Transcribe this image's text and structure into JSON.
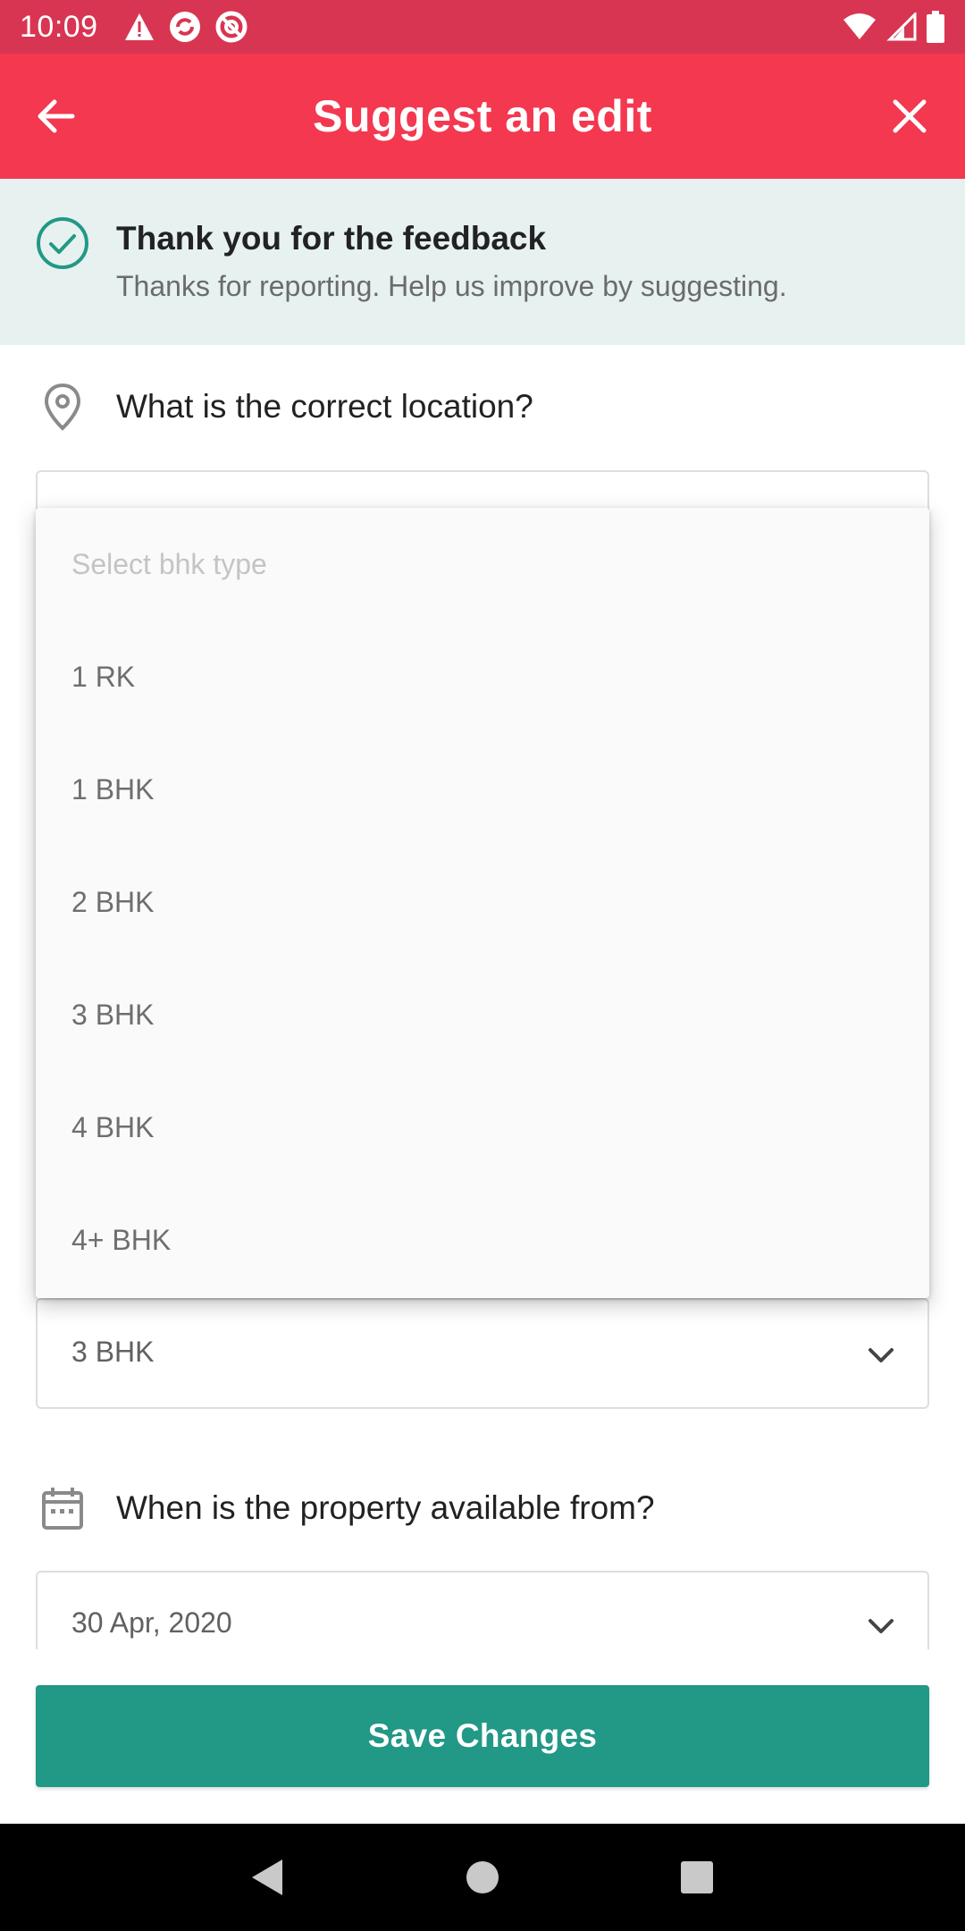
{
  "status_bar": {
    "time": "10:09",
    "left_icons": [
      "warning-icon",
      "sync-icon",
      "no-sign-icon"
    ],
    "right_icons": [
      "wifi-icon",
      "signal-icon",
      "battery-icon"
    ]
  },
  "app_bar": {
    "title": "Suggest an edit",
    "back_icon": "arrow-left-icon",
    "close_icon": "close-icon",
    "color": "#f3384f"
  },
  "feedback": {
    "title": "Thank you for the feedback",
    "subtitle": "Thanks for reporting. Help us improve by suggesting."
  },
  "location_question": {
    "text": "What is the correct location?"
  },
  "bhk_dropdown": {
    "placeholder": "Select bhk type",
    "options": [
      "1 RK",
      "1 BHK",
      "2 BHK",
      "3 BHK",
      "4 BHK",
      "4+ BHK"
    ],
    "selected": "3 BHK"
  },
  "availability_question": {
    "text": "When is the property available from?",
    "date_value": "30 Apr, 2020"
  },
  "save_button": {
    "label": "Save Changes",
    "color": "#229886"
  },
  "nav_bar": {
    "icons": [
      "back-triangle-icon",
      "home-circle-icon",
      "recents-square-icon"
    ]
  }
}
